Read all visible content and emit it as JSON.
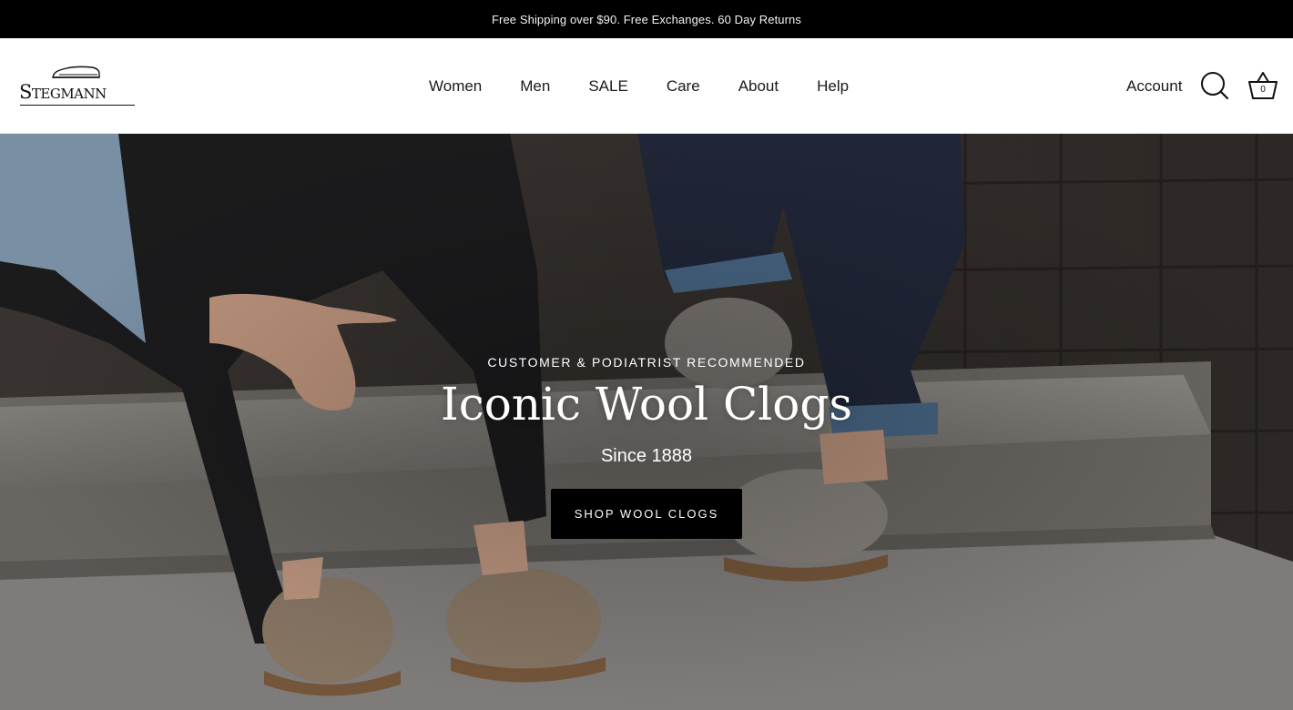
{
  "announcement": {
    "text": "Free Shipping over $90. Free Exchanges. 60 Day Returns"
  },
  "header": {
    "logo_text": "Stegmann",
    "nav": [
      {
        "label": "Women"
      },
      {
        "label": "Men"
      },
      {
        "label": "SALE"
      },
      {
        "label": "Care"
      },
      {
        "label": "About"
      },
      {
        "label": "Help"
      }
    ],
    "account_label": "Account",
    "cart_count": "0"
  },
  "hero": {
    "eyebrow": "CUSTOMER & PODIATRIST RECOMMENDED",
    "headline": "Iconic Wool Clogs",
    "subheadline": "Since 1888",
    "cta_label": "SHOP WOOL CLOGS"
  },
  "icons": [
    "shoe-logo-icon",
    "search-icon",
    "basket-icon"
  ],
  "colors": {
    "announcement_bg": "#000000",
    "button_bg": "#000000",
    "header_bg": "#ffffff"
  }
}
